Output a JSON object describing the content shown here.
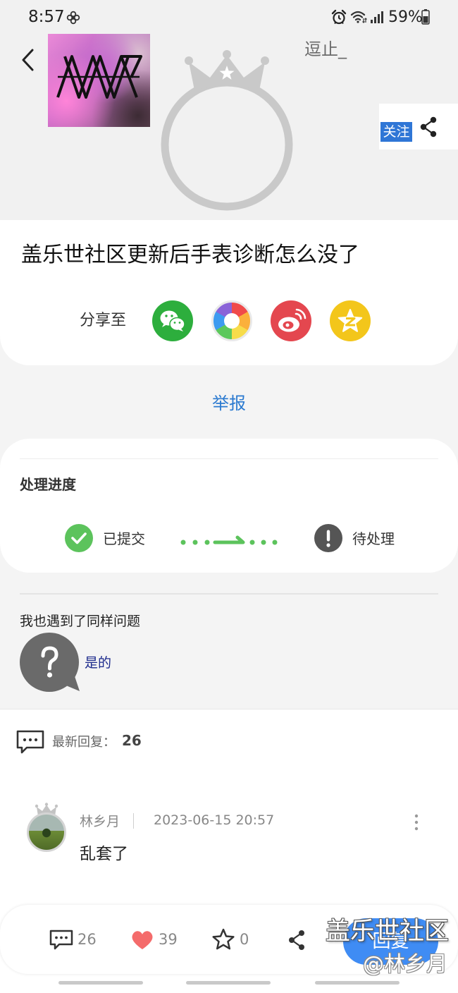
{
  "status_bar": {
    "time": "8:57",
    "battery_percent": "59%",
    "icons": [
      "fan-icon",
      "alarm-icon",
      "wifi-icon",
      "signal-icon",
      "battery-icon"
    ]
  },
  "header": {
    "back_icon": "chevron-left-icon",
    "username": "逗止_",
    "follow_label": "关注",
    "share_icon": "share-icon"
  },
  "post": {
    "title": "盖乐世社区更新后手表诊断怎么没了",
    "share_label": "分享至",
    "share_targets": [
      {
        "icon": "wechat-icon",
        "color": "#2dae3d"
      },
      {
        "icon": "moments-icon",
        "color": "#f5a623"
      },
      {
        "icon": "weibo-icon",
        "color": "#e4474f"
      },
      {
        "icon": "qzone-icon",
        "color": "#f3c61b"
      }
    ]
  },
  "report_label": "举报",
  "progress": {
    "title": "处理进度",
    "steps": [
      {
        "label": "已提交",
        "icon": "check-circle-icon"
      },
      {
        "label": "待处理",
        "icon": "exclamation-circle-icon"
      }
    ]
  },
  "same_issue": {
    "question": "我也遇到了同样问题",
    "answer": "是的",
    "icon": "question-bubble-icon"
  },
  "replies": {
    "label": "最新回复：",
    "count": "26",
    "icon": "comment-icon"
  },
  "comments": [
    {
      "author": "林乡月",
      "time": "2023-06-15 20:57",
      "text": "乱套了"
    }
  ],
  "action_bar": {
    "comment_count": "26",
    "like_count": "39",
    "favorite_count": "0",
    "reply_label": "回复",
    "icons": [
      "comment-icon",
      "heart-icon",
      "star-icon",
      "share-icon"
    ]
  },
  "watermark": {
    "brand": "盖乐世社区",
    "author": "@林乡月"
  },
  "colors": {
    "accent": "#2b7ad0",
    "follow_bg": "#2f76d6",
    "success": "#5cc35c",
    "like": "#f46b6b",
    "reply_button": "#3f8cf4",
    "answer": "#1c2a8c"
  }
}
